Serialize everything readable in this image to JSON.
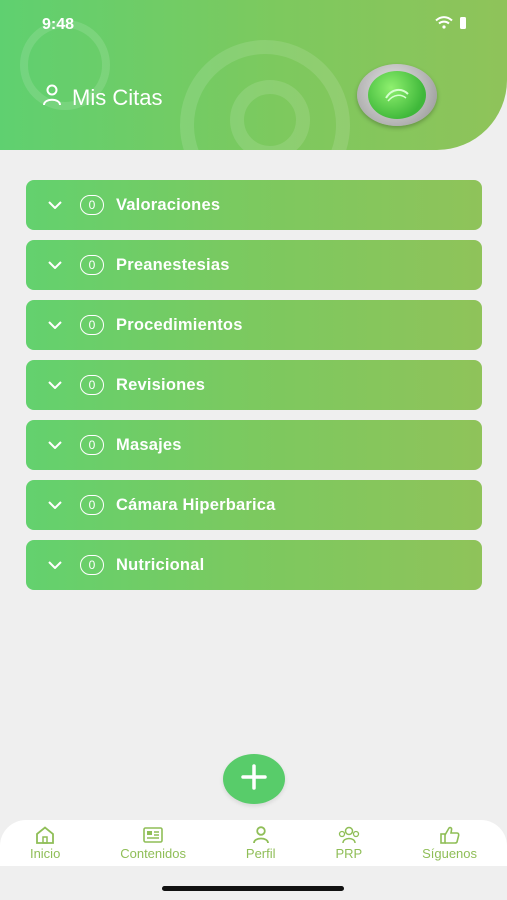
{
  "status": {
    "time": "9:48"
  },
  "header": {
    "title": "Mis Citas"
  },
  "categories": [
    {
      "label": "Valoraciones",
      "count": "0"
    },
    {
      "label": "Preanestesias",
      "count": "0"
    },
    {
      "label": "Procedimientos",
      "count": "0"
    },
    {
      "label": "Revisiones",
      "count": "0"
    },
    {
      "label": "Masajes",
      "count": "0"
    },
    {
      "label": "Cámara Hiperbarica",
      "count": "0"
    },
    {
      "label": "Nutricional",
      "count": "0"
    }
  ],
  "tabs": [
    {
      "label": "Inicio",
      "icon": "home-icon"
    },
    {
      "label": "Contenidos",
      "icon": "newspaper-icon"
    },
    {
      "label": "Perfil",
      "icon": "user-icon"
    },
    {
      "label": "PRP",
      "icon": "group-icon"
    },
    {
      "label": "Síguenos",
      "icon": "thumbs-up-icon"
    }
  ],
  "colors": {
    "accent": "#5fd070",
    "accent_end": "#8fc35a",
    "tab_text": "#8fbe57",
    "background": "#efefef"
  }
}
